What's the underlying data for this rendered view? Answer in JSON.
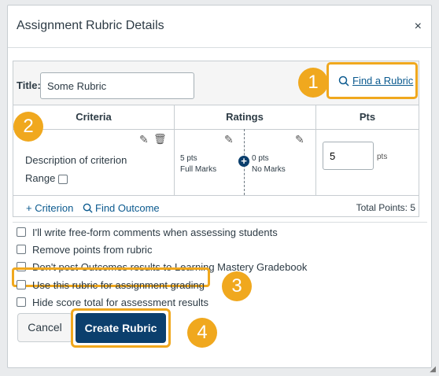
{
  "dialog": {
    "title": "Assignment Rubric Details",
    "close_label": "×"
  },
  "rubric": {
    "title_label": "Title:",
    "title_value": "Some Rubric",
    "find_rubric": "Find a Rubric",
    "headers": {
      "criteria": "Criteria",
      "ratings": "Ratings",
      "pts": "Pts"
    },
    "criterion": {
      "description": "Description of criterion",
      "range_label": "Range",
      "ratings": [
        {
          "pts": "5 pts",
          "label": "Full Marks"
        },
        {
          "pts": "0 pts",
          "label": "No Marks"
        }
      ],
      "points_value": "5",
      "points_suffix": "pts"
    },
    "add_criterion": "+ Criterion",
    "find_outcome": "Find Outcome",
    "total_points": "Total Points: 5"
  },
  "options": [
    "I'll write free-form comments when assessing students",
    "Remove points from rubric",
    "Don't post Outcomes results to Learning Mastery Gradebook",
    "Use this rubric for assignment grading",
    "Hide score total for assessment results"
  ],
  "buttons": {
    "cancel": "Cancel",
    "create": "Create Rubric"
  },
  "callouts": [
    "1",
    "2",
    "3",
    "4"
  ],
  "colors": {
    "callout": "#f0a81e",
    "primary": "#0b3f6d",
    "link": "#0b5a8f"
  }
}
